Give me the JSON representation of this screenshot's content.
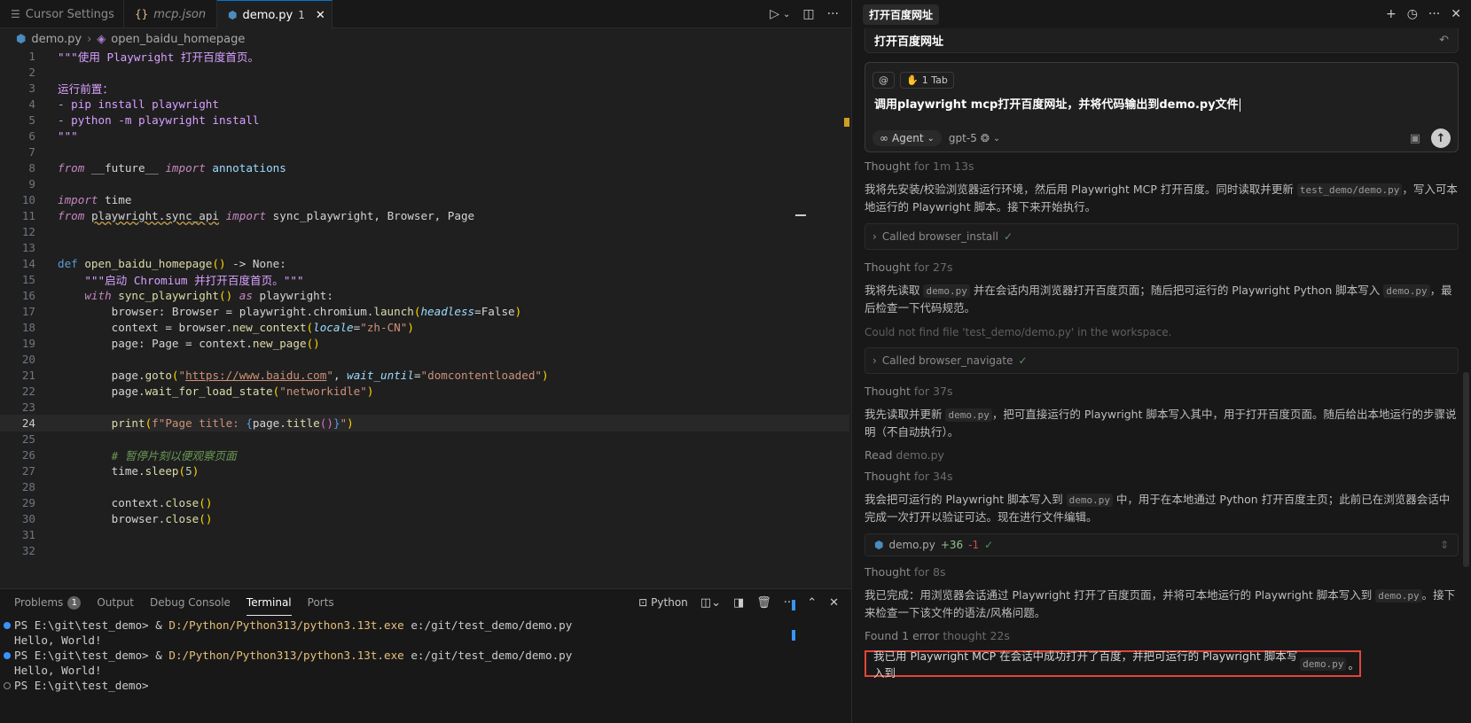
{
  "editor": {
    "tabs": [
      {
        "label": "Cursor Settings",
        "icon": "settings-icon"
      },
      {
        "label": "mcp.json",
        "icon": "json-icon"
      },
      {
        "label": "demo.py",
        "badge": "1",
        "icon": "python-icon"
      }
    ],
    "breadcrumb": {
      "file": "demo.py",
      "symbol": "open_baidu_homepage"
    },
    "current_line": 24,
    "lines": [
      {
        "n": "1",
        "html": "<span class='k-doc'>\"\"\"使用 Playwright 打开百度首页。</span>"
      },
      {
        "n": "2",
        "html": ""
      },
      {
        "n": "3",
        "html": "<span class='k-doc'>运行前置：</span>"
      },
      {
        "n": "4",
        "html": "<span class='k-doc'>- pip install playwright</span>"
      },
      {
        "n": "5",
        "html": "<span class='k-doc'>- python -m playwright install</span>"
      },
      {
        "n": "6",
        "html": "<span class='k-doc'>\"\"\"</span>"
      },
      {
        "n": "7",
        "html": ""
      },
      {
        "n": "8",
        "html": "<span class='k-kw'>from</span><span class='k-plain'> __future__ </span><span class='k-kw'>import</span><span class='k-var'> annotations</span>"
      },
      {
        "n": "9",
        "html": ""
      },
      {
        "n": "10",
        "html": "<span class='k-kw'>import</span><span class='k-plain'> time</span>"
      },
      {
        "n": "11",
        "html": "<span class='k-kw'>from</span><span class='k-plain'> </span><span class='k-plain squig'>playwright.sync_api</span><span class='k-plain'> </span><span class='k-kw'>import</span><span class='k-plain'> sync_playwright, Browser, Page</span>"
      },
      {
        "n": "12",
        "html": ""
      },
      {
        "n": "13",
        "html": ""
      },
      {
        "n": "14",
        "html": "<span class='k-def'>def</span><span class='k-fn'> open_baidu_homepage</span><span class='k-par'>()</span><span class='k-plain'> -&gt; None:</span>"
      },
      {
        "n": "15",
        "html": "<span class='k-doc'>    \"\"\"启动 Chromium 并打开百度首页。\"\"\"</span>"
      },
      {
        "n": "16",
        "html": "<span class='k-kw'>    with</span><span class='k-fn'> sync_playwright</span><span class='k-par'>()</span><span class='k-kw'> as</span><span class='k-plain'> playwright:</span>"
      },
      {
        "n": "17",
        "html": "<span class='k-plain'>        browser: Browser = playwright.chromium.</span><span class='k-fn'>launch</span><span class='k-par'>(</span><span class='k-it'>headless</span><span class='k-plain'>=False</span><span class='k-par'>)</span>"
      },
      {
        "n": "18",
        "html": "<span class='k-plain'>        context = browser.</span><span class='k-fn'>new_context</span><span class='k-par'>(</span><span class='k-it'>locale</span><span class='k-plain'>=</span><span class='k-str'>\"zh-CN\"</span><span class='k-par'>)</span>"
      },
      {
        "n": "19",
        "html": "<span class='k-plain'>        page: Page = context.</span><span class='k-fn'>new_page</span><span class='k-par'>()</span>"
      },
      {
        "n": "20",
        "html": ""
      },
      {
        "n": "21",
        "html": "<span class='k-plain'>        page.</span><span class='k-fn'>goto</span><span class='k-par'>(</span><span class='k-str'>\"</span><span class='k-url'>https://www.baidu.com</span><span class='k-str'>\"</span><span class='k-plain'>, </span><span class='k-it'>wait_until</span><span class='k-plain'>=</span><span class='k-str'>\"domcontentloaded\"</span><span class='k-par'>)</span>"
      },
      {
        "n": "22",
        "html": "<span class='k-plain'>        page.</span><span class='k-fn'>wait_for_load_state</span><span class='k-par'>(</span><span class='k-str'>\"networkidle\"</span><span class='k-par'>)</span>"
      },
      {
        "n": "23",
        "html": ""
      },
      {
        "n": "24",
        "html": "<span class='k-fn'>        print</span><span class='k-par'>(</span><span class='k-str'>f\"Page title: </span><span class='k-def'>{</span><span class='k-plain'>page.</span><span class='k-fn'>title</span><span class='k-par2'>()</span><span class='k-def'>}</span><span class='k-str'>\"</span><span class='k-par'>)</span>"
      },
      {
        "n": "25",
        "html": ""
      },
      {
        "n": "26",
        "html": "<span class='k-cm'>        # 暂停片刻以便观察页面</span>"
      },
      {
        "n": "27",
        "html": "<span class='k-plain'>        time.</span><span class='k-fn'>sleep</span><span class='k-par'>(</span><span class='k-num'>5</span><span class='k-par'>)</span>"
      },
      {
        "n": "28",
        "html": ""
      },
      {
        "n": "29",
        "html": "<span class='k-plain'>        context.</span><span class='k-fn'>close</span><span class='k-par'>()</span>"
      },
      {
        "n": "30",
        "html": "<span class='k-plain'>        browser.</span><span class='k-fn'>close</span><span class='k-par'>()</span>"
      },
      {
        "n": "31",
        "html": ""
      },
      {
        "n": "32",
        "html": ""
      }
    ]
  },
  "panel": {
    "tabs": {
      "problems": "Problems",
      "problems_count": "1",
      "output": "Output",
      "debug": "Debug Console",
      "terminal": "Terminal",
      "ports": "Ports"
    },
    "shell_label": "Python",
    "terminal_lines": [
      {
        "dot": "blue",
        "prompt": "PS E:\\git\\test_demo> & ",
        "path": "D:/Python/Python313/python3.13t.exe",
        "rest": " e:/git/test_demo/demo.py"
      },
      {
        "dot": "none",
        "prompt": "Hello, World!",
        "path": "",
        "rest": ""
      },
      {
        "dot": "blue",
        "prompt": "PS E:\\git\\test_demo> & ",
        "path": "D:/Python/Python313/python3.13t.exe",
        "rest": " e:/git/test_demo/demo.py"
      },
      {
        "dot": "none",
        "prompt": "Hello, World!",
        "path": "",
        "rest": ""
      },
      {
        "dot": "hollow",
        "prompt": "PS E:\\git\\test_demo>",
        "path": "",
        "rest": ""
      }
    ]
  },
  "chat": {
    "tab_title": "打开百度网址",
    "previous_message": "打开百度网址",
    "composer": {
      "mention": "@",
      "tab_chip": "1 Tab",
      "text": "调用playwright mcp打开百度网址，并将代码输出到demo.py文件",
      "mode": "Agent",
      "model": "gpt-5"
    },
    "stream": {
      "t1_label": "Thought",
      "t1_time": "for 1m 13s",
      "p1a": "我将先安装/校验浏览器运行环境，然后用 Playwright MCP 打开百度。同时读取并更新 ",
      "p1_code": "test_demo/demo.py",
      "p1b": "，写入可本地运行的 Playwright 脚本。接下来开始执行。",
      "call1": "Called browser_install",
      "t2_label": "Thought",
      "t2_time": "for 27s",
      "p2a": "我将先读取 ",
      "p2_code1": "demo.py",
      "p2b": " 并在会话内用浏览器打开百度页面；随后把可运行的 Playwright Python 脚本写入 ",
      "p2_code2": "demo.py",
      "p2c": "，最后检查一下代码规范。",
      "notfound": "Could not find file 'test_demo/demo.py' in the workspace.",
      "call2": "Called browser_navigate",
      "t3_label": "Thought",
      "t3_time": "for 37s",
      "p3a": "我先读取并更新 ",
      "p3_code": "demo.py",
      "p3b": "，把可直接运行的 Playwright 脚本写入其中，用于打开百度页面。随后给出本地运行的步骤说明（不自动执行）。",
      "read_label": "Read",
      "read_file": "demo.py",
      "t4_label": "Thought",
      "t4_time": "for 34s",
      "p4a": "我会把可运行的 Playwright 脚本写入到 ",
      "p4_code": "demo.py",
      "p4b": " 中，用于在本地通过 Python 打开百度主页；此前已在浏览器会话中完成一次打开以验证可达。现在进行文件编辑。",
      "diff_file": "demo.py",
      "diff_add": "+36",
      "diff_del": "-1",
      "t5_label": "Thought",
      "t5_time": "for 8s",
      "p5a": "我已完成：用浏览器会话通过 Playwright 打开了百度页面，并将可本地运行的 Playwright 脚本写入到 ",
      "p5_code": "demo.py",
      "p5b": "。接下来检查一下该文件的语法/风格问题。",
      "err_label": "Found 1 error",
      "err_time": "thought 22s",
      "final_a": "我已用 Playwright MCP 在会话中成功打开了百度，并把可运行的 Playwright 脚本写入到 ",
      "final_code": "demo.py",
      "final_b": "。"
    }
  },
  "colors": {
    "accent": "#0078d4",
    "highlight_box": "#e0463a"
  }
}
